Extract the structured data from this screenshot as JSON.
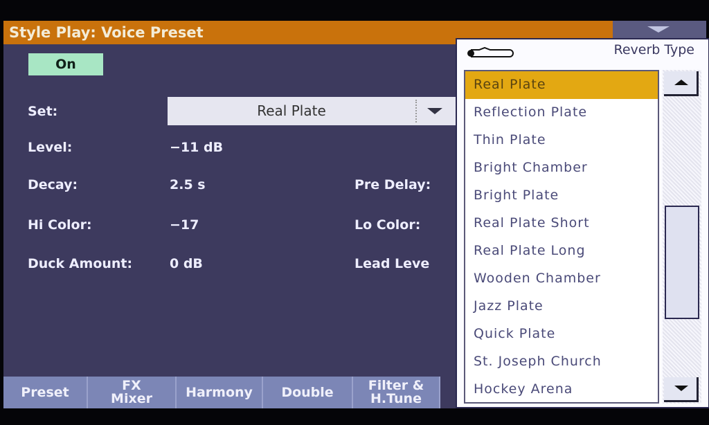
{
  "header": {
    "title": "Style Play: Voice Preset"
  },
  "on_button": "On",
  "params": {
    "set": {
      "label": "Set:",
      "value": "Real Plate"
    },
    "level": {
      "label": "Level:",
      "value": "−11 dB"
    },
    "decay": {
      "label": "Decay:",
      "value": "2.5 s"
    },
    "pre_delay": {
      "label": "Pre Delay:"
    },
    "hi_color": {
      "label": "Hi Color:",
      "value": "−17"
    },
    "lo_color": {
      "label": "Lo Color:"
    },
    "duck_amount": {
      "label": "Duck Amount:",
      "value": "0 dB"
    },
    "lead_level": {
      "label": "Lead Leve"
    }
  },
  "tabs": [
    {
      "label": "Preset"
    },
    {
      "label": "FX\nMixer"
    },
    {
      "label": "Harmony"
    },
    {
      "label": "Double"
    },
    {
      "label": "Filter &\nH.Tune"
    }
  ],
  "popup": {
    "title": "Reverb Type",
    "selected": "Real Plate",
    "items": [
      "Real Plate",
      "Reflection Plate",
      "Thin Plate",
      "Bright Chamber",
      "Bright Plate",
      "Real Plate Short",
      "Real Plate Long",
      "Wooden Chamber",
      "Jazz Plate",
      "Quick Plate",
      "St. Joseph Church",
      "Hockey Arena"
    ],
    "scroll_position": 0.35
  },
  "colors": {
    "title_bar": "#c9720c",
    "background": "#3d3a5e",
    "selected": "#e3a812",
    "on": "#a8e6c4"
  }
}
